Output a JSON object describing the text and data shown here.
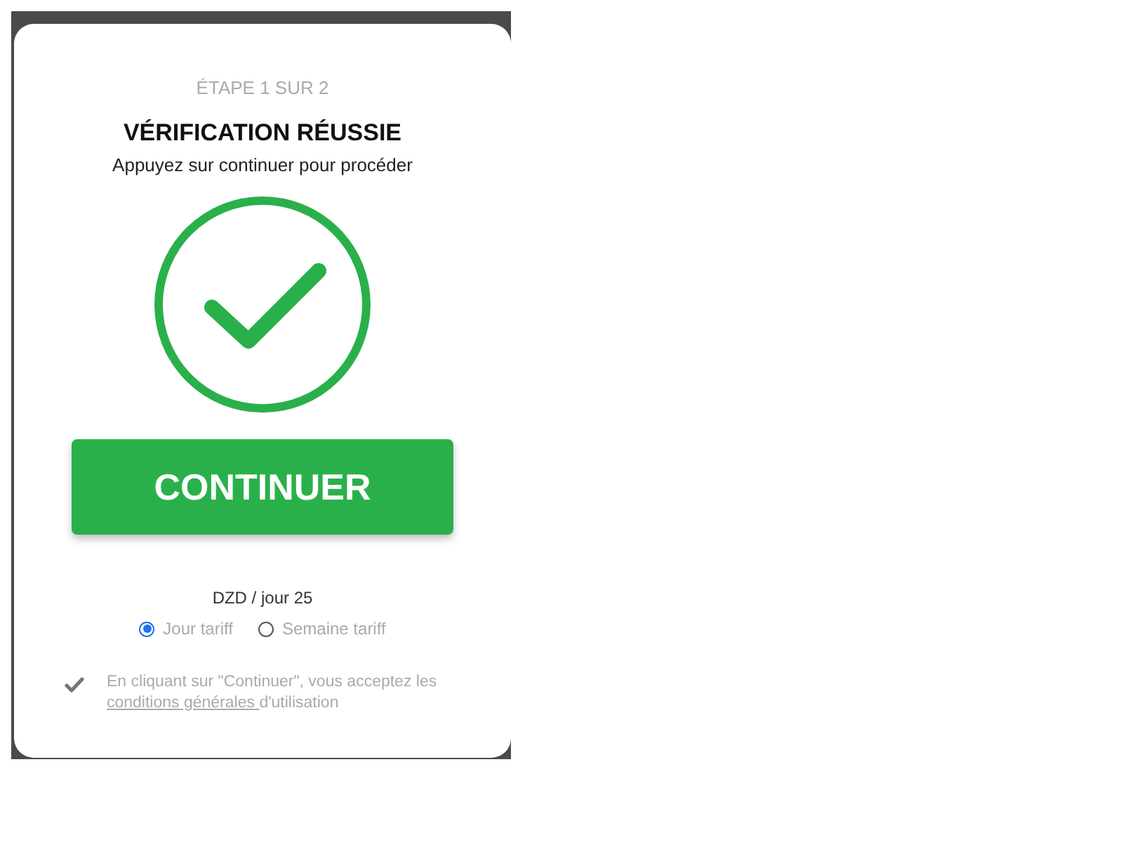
{
  "step": "ÉTAPE 1 SUR 2",
  "title": "VÉRIFICATION RÉUSSIE",
  "subtitle": "Appuyez sur continuer pour procéder",
  "continue_button": "CONTINUER",
  "price": "DZD / jour 25",
  "tariffs": [
    {
      "label": "Jour tariff",
      "selected": true
    },
    {
      "label": "Semaine tariff",
      "selected": false
    }
  ],
  "terms": {
    "before": "En cliquant sur \"Continuer\", vous acceptez les ",
    "link": "conditions générales ",
    "after": "d'utilisation"
  }
}
